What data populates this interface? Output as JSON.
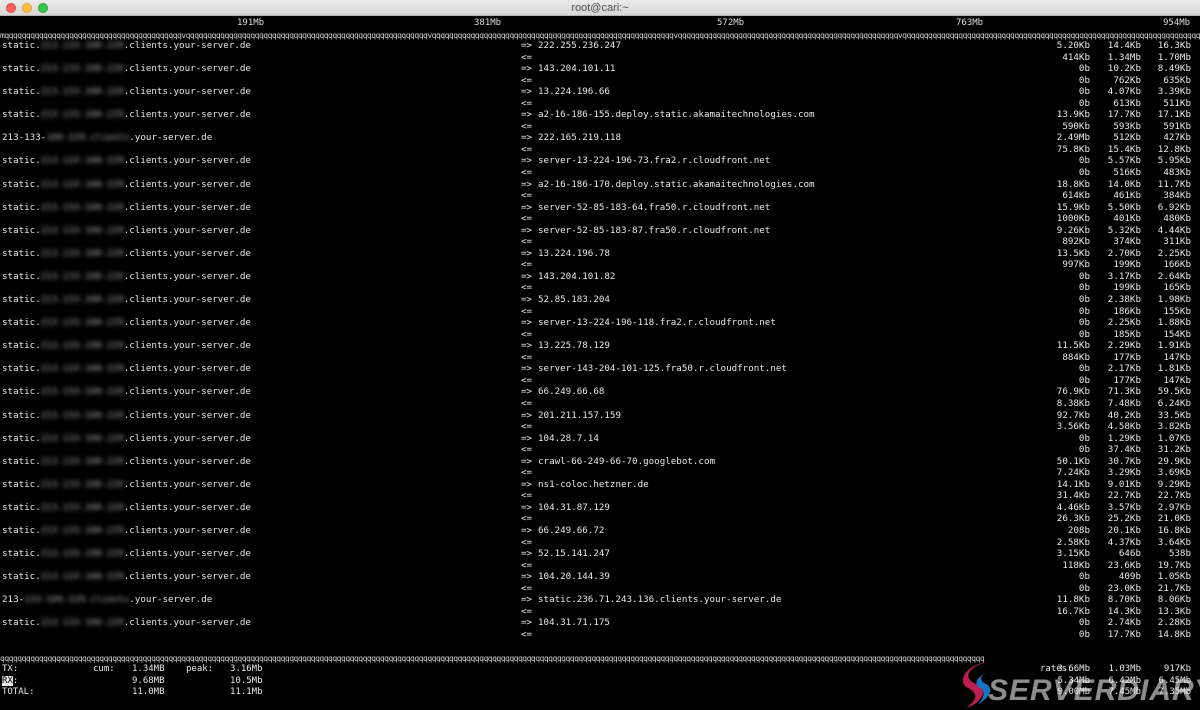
{
  "window": {
    "title": "root@cari:~"
  },
  "scale": [
    "191Mb",
    "381Mb",
    "572Mb",
    "763Mb",
    "954Mb"
  ],
  "ruler_text": "mqqqqqqqqqqqqqqqqqqqqqqqqqqqqqqqqqqqqqqqqqvqqqqqqqqqqqqqqqqqqqqqqqqqqqqqqqqqqqqqqqqqqqqqqqqqqqqqqqqvqqqqqqqqqqqqqqqqqqqqqqqqqqqqqqqqqqqqqqqqqqqqqqqqqqqqqqqqvqqqqqqqqqqqqqqqqqqqqqqqqqqqqqqqqqqqqqqqqqqqqqqqqqqqvqqqqqqqqqqqqqqqqqqqqqqqqqqqqqqqqqqqqqqqqqqqqqqqqqqqqqqqqqqqqqqqqqqqqqqqqqqqqqqq",
  "bottom_ruler_text": "qqqqqqqqqqqqqqqqqqqqqqqqqqqqqqqqqqqqqqqqqqqqqqqqqqqqqqqqqqqqqqqqqqqqqqqqqqqqqqqqqqqqqqqqqqqqqqqqqqqqqqqqqqqqqqqqqqqqqqqqqqqqqqqqqqqqqqqqqqqqqqqqqqqqqqqqqqqqqqqqqqqqqqqqqqqqqqqqqqqqqqqqqqqqqqqqqqqqqqqqqqqqqqqqqqqqqqqqqqqqqqqqqqqq",
  "connections": [
    {
      "host_pre": "static.",
      "host_blur": "213-133-100-229",
      "host_post": ".clients.your-server.de",
      "remote": "222.255.236.247",
      "out": [
        "5.20Kb",
        "14.4Kb",
        "16.3Kb"
      ],
      "in": [
        "414Kb",
        "1.34Mb",
        "1.70Mb"
      ]
    },
    {
      "host_pre": "static.",
      "host_blur": "213-133-100-229",
      "host_post": ".clients.your-server.de",
      "remote": "143.204.101.11",
      "out": [
        "0b",
        "10.2Kb",
        "8.49Kb"
      ],
      "in": [
        "0b",
        "762Kb",
        "635Kb"
      ]
    },
    {
      "host_pre": "static.",
      "host_blur": "213-133-100-229",
      "host_post": ".clients.your-server.de",
      "remote": "13.224.196.66",
      "out": [
        "0b",
        "4.07Kb",
        "3.39Kb"
      ],
      "in": [
        "0b",
        "613Kb",
        "511Kb"
      ]
    },
    {
      "host_pre": "static.",
      "host_blur": "213-133-100-229",
      "host_post": ".clients.your-server.de",
      "remote": "a2-16-186-155.deploy.static.akamaitechnologies.com",
      "out": [
        "13.9Kb",
        "17.7Kb",
        "17.1Kb"
      ],
      "in": [
        "590Kb",
        "593Kb",
        "591Kb"
      ]
    },
    {
      "host_pre": "213-133-",
      "host_blur": "100-229.clients",
      "host_post": ".your-server.de",
      "remote": "222.165.219.118",
      "out": [
        "2.49Mb",
        "512Kb",
        "427Kb"
      ],
      "in": [
        "75.8Kb",
        "15.4Kb",
        "12.8Kb"
      ]
    },
    {
      "host_pre": "static.",
      "host_blur": "213-133-100-229",
      "host_post": ".clients.your-server.de",
      "remote": "server-13-224-196-73.fra2.r.cloudfront.net",
      "out": [
        "0b",
        "5.57Kb",
        "5.95Kb"
      ],
      "in": [
        "0b",
        "516Kb",
        "483Kb"
      ]
    },
    {
      "host_pre": "static.",
      "host_blur": "213-133-100-229",
      "host_post": ".clients.your-server.de",
      "remote": "a2-16-186-170.deploy.static.akamaitechnologies.com",
      "out": [
        "18.8Kb",
        "14.0Kb",
        "11.7Kb"
      ],
      "in": [
        "614Kb",
        "461Kb",
        "384Kb"
      ]
    },
    {
      "host_pre": "static.",
      "host_blur": "213-133-100-229",
      "host_post": ".clients.your-server.de",
      "remote": "server-52-85-183-64.fra50.r.cloudfront.net",
      "out": [
        "15.9Kb",
        "5.50Kb",
        "6.92Kb"
      ],
      "in": [
        "1000Kb",
        "401Kb",
        "480Kb"
      ]
    },
    {
      "host_pre": "static.",
      "host_blur": "213-133-100-229",
      "host_post": ".clients.your-server.de",
      "remote": "server-52-85-183-87.fra50.r.cloudfront.net",
      "out": [
        "9.26Kb",
        "5.32Kb",
        "4.44Kb"
      ],
      "in": [
        "892Kb",
        "374Kb",
        "311Kb"
      ]
    },
    {
      "host_pre": "static.",
      "host_blur": "213-133-100-229",
      "host_post": ".clients.your-server.de",
      "remote": "13.224.196.78",
      "out": [
        "13.5Kb",
        "2.70Kb",
        "2.25Kb"
      ],
      "in": [
        "997Kb",
        "199Kb",
        "166Kb"
      ]
    },
    {
      "host_pre": "static.",
      "host_blur": "213-133-100-229",
      "host_post": ".clients.your-server.de",
      "remote": "143.204.101.82",
      "out": [
        "0b",
        "3.17Kb",
        "2.64Kb"
      ],
      "in": [
        "0b",
        "199Kb",
        "165Kb"
      ]
    },
    {
      "host_pre": "static.",
      "host_blur": "213-133-100-229",
      "host_post": ".clients.your-server.de",
      "remote": "52.85.183.204",
      "out": [
        "0b",
        "2.38Kb",
        "1.98Kb"
      ],
      "in": [
        "0b",
        "186Kb",
        "155Kb"
      ]
    },
    {
      "host_pre": "static.",
      "host_blur": "213-133-100-229",
      "host_post": ".clients.your-server.de",
      "remote": "server-13-224-196-118.fra2.r.cloudfront.net",
      "out": [
        "0b",
        "2.25Kb",
        "1.88Kb"
      ],
      "in": [
        "0b",
        "185Kb",
        "154Kb"
      ]
    },
    {
      "host_pre": "static.",
      "host_blur": "213-133-100-229",
      "host_post": ".clients.your-server.de",
      "remote": "13.225.78.129",
      "out": [
        "11.5Kb",
        "2.29Kb",
        "1.91Kb"
      ],
      "in": [
        "884Kb",
        "177Kb",
        "147Kb"
      ]
    },
    {
      "host_pre": "static.",
      "host_blur": "213-133-100-229",
      "host_post": ".clients.your-server.de",
      "remote": "server-143-204-101-125.fra50.r.cloudfront.net",
      "out": [
        "0b",
        "2.17Kb",
        "1.81Kb"
      ],
      "in": [
        "0b",
        "177Kb",
        "147Kb"
      ]
    },
    {
      "host_pre": "static.",
      "host_blur": "213-133-100-229",
      "host_post": ".clients.your-server.de",
      "remote": "66.249.66.68",
      "out": [
        "76.9Kb",
        "71.3Kb",
        "59.5Kb"
      ],
      "in": [
        "8.38Kb",
        "7.48Kb",
        "6.24Kb"
      ]
    },
    {
      "host_pre": "static.",
      "host_blur": "213-133-100-229",
      "host_post": ".clients.your-server.de",
      "remote": "201.211.157.159",
      "out": [
        "92.7Kb",
        "40.2Kb",
        "33.5Kb"
      ],
      "in": [
        "3.56Kb",
        "4.58Kb",
        "3.82Kb"
      ]
    },
    {
      "host_pre": "static.",
      "host_blur": "213-133-100-229",
      "host_post": ".clients.your-server.de",
      "remote": "104.28.7.14",
      "out": [
        "0b",
        "1.29Kb",
        "1.07Kb"
      ],
      "in": [
        "0b",
        "37.4Kb",
        "31.2Kb"
      ]
    },
    {
      "host_pre": "static.",
      "host_blur": "213-133-100-229",
      "host_post": ".clients.your-server.de",
      "remote": "crawl-66-249-66-70.googlebot.com",
      "out": [
        "50.1Kb",
        "30.7Kb",
        "29.9Kb"
      ],
      "in": [
        "7.24Kb",
        "3.29Kb",
        "3.69Kb"
      ]
    },
    {
      "host_pre": "static.",
      "host_blur": "213-133-100-229",
      "host_post": ".clients.your-server.de",
      "remote": "ns1-coloc.hetzner.de",
      "out": [
        "14.1Kb",
        "9.01Kb",
        "9.29Kb"
      ],
      "in": [
        "31.4Kb",
        "22.7Kb",
        "22.7Kb"
      ]
    },
    {
      "host_pre": "static.",
      "host_blur": "213-133-100-229",
      "host_post": ".clients.your-server.de",
      "remote": "104.31.87.129",
      "out": [
        "4.46Kb",
        "3.57Kb",
        "2.97Kb"
      ],
      "in": [
        "26.3Kb",
        "25.2Kb",
        "21.0Kb"
      ]
    },
    {
      "host_pre": "static.",
      "host_blur": "213-133-100-229",
      "host_post": ".clients.your-server.de",
      "remote": "66.249.66.72",
      "out": [
        "208b",
        "20.1Kb",
        "16.8Kb"
      ],
      "in": [
        "2.58Kb",
        "4.37Kb",
        "3.64Kb"
      ]
    },
    {
      "host_pre": "static.",
      "host_blur": "213-133-100-229",
      "host_post": ".clients.your-server.de",
      "remote": "52.15.141.247",
      "out": [
        "3.15Kb",
        "646b",
        "538b"
      ],
      "in": [
        "118Kb",
        "23.6Kb",
        "19.7Kb"
      ]
    },
    {
      "host_pre": "static.",
      "host_blur": "213-133-100-229",
      "host_post": ".clients.your-server.de",
      "remote": "104.20.144.39",
      "out": [
        "0b",
        "409b",
        "1.05Kb"
      ],
      "in": [
        "0b",
        "23.0Kb",
        "21.7Kb"
      ]
    },
    {
      "host_pre": "213-",
      "host_blur": "133-100-229.clients",
      "host_post": ".your-server.de",
      "remote": "static.236.71.243.136.clients.your-server.de",
      "out": [
        "11.8Kb",
        "8.70Kb",
        "8.06Kb"
      ],
      "in": [
        "16.7Kb",
        "14.3Kb",
        "13.3Kb"
      ]
    },
    {
      "host_pre": "static.",
      "host_blur": "213-133-100-229",
      "host_post": ".clients.your-server.de",
      "remote": "104.31.71.175",
      "out": [
        "0b",
        "2.74Kb",
        "2.28Kb"
      ],
      "in": [
        "0b",
        "17.7Kb",
        "14.8Kb"
      ]
    }
  ],
  "arrows": {
    "out": "=>",
    "in": "<="
  },
  "summary": {
    "cum_label": "cum:",
    "peak_label": "peak:",
    "rates_label": "rates:",
    "rows": [
      {
        "label": "TX:",
        "cum": "1.34MB",
        "peak": "3.16Mb",
        "rates": [
          "3.66Mb",
          "1.03Mb",
          "917Kb"
        ]
      },
      {
        "label": "RX:",
        "cum": "9.68MB",
        "peak": "10.5Mb",
        "rates": [
          "5.34Mb",
          "6.42Mb",
          "6.45Mb"
        ]
      },
      {
        "label": "TOTAL:",
        "cum": "11.0MB",
        "peak": "11.1Mb",
        "rates": [
          "9.00Mb",
          "7.45Mb",
          "7.35Mb"
        ]
      }
    ]
  },
  "watermark": {
    "text": "SERVERDIARY"
  }
}
